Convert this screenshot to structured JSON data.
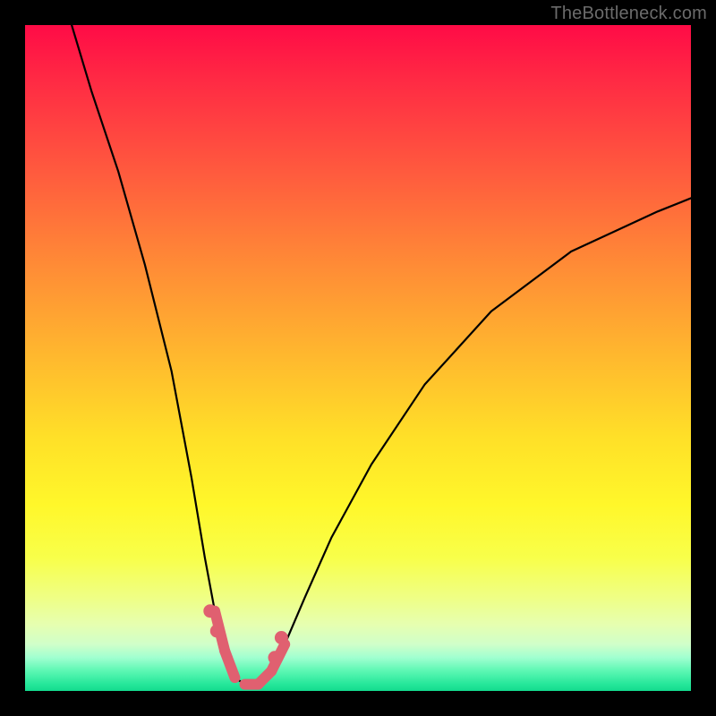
{
  "watermark": "TheBottleneck.com",
  "chart_data": {
    "type": "line",
    "title": "",
    "xlabel": "",
    "ylabel": "",
    "xlim": [
      0,
      100
    ],
    "ylim": [
      0,
      100
    ],
    "grid": false,
    "series": [
      {
        "name": "bottleneck-curve",
        "x": [
          7,
          10,
          14,
          18,
          22,
          25,
          27,
          28.5,
          30,
          31.5,
          33,
          35,
          37,
          39,
          42,
          46,
          52,
          60,
          70,
          82,
          95,
          100
        ],
        "values": [
          100,
          90,
          78,
          64,
          48,
          32,
          20,
          12,
          6,
          2,
          1,
          1,
          3,
          7,
          14,
          23,
          34,
          46,
          57,
          66,
          72,
          74
        ]
      }
    ],
    "annotations": {
      "pink_beads_x_range": [
        27.5,
        38.5
      ],
      "pink_beads_y_range": [
        0,
        13
      ]
    },
    "background": {
      "type": "vertical-gradient",
      "stops": [
        {
          "pos": 0.0,
          "color": "#ff0b46"
        },
        {
          "pos": 0.22,
          "color": "#ff5a3e"
        },
        {
          "pos": 0.5,
          "color": "#ffb92e"
        },
        {
          "pos": 0.72,
          "color": "#fff72a"
        },
        {
          "pos": 0.9,
          "color": "#e6ffb0"
        },
        {
          "pos": 1.0,
          "color": "#13db8e"
        }
      ]
    }
  }
}
